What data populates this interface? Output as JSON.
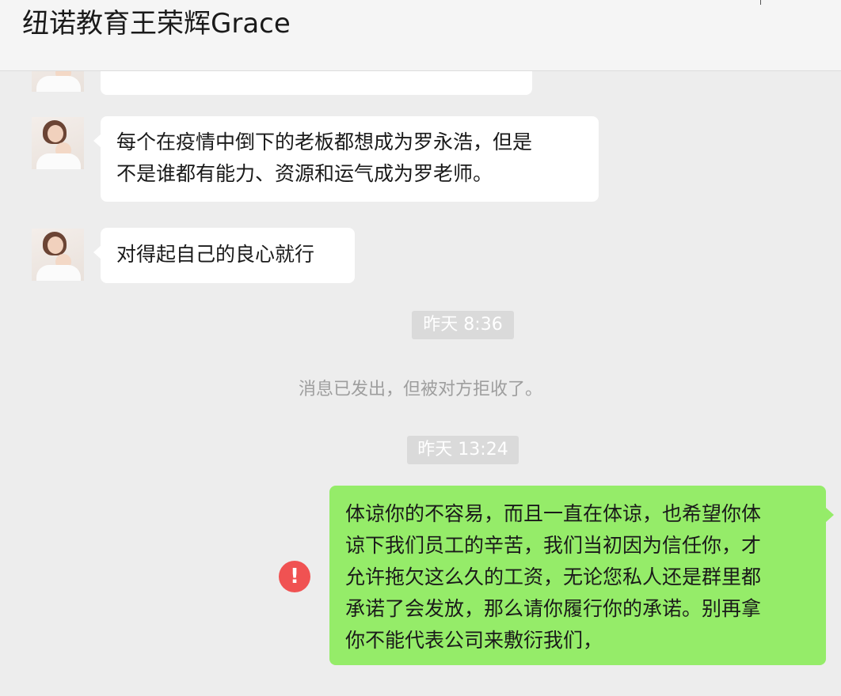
{
  "header": {
    "title": "纽诺教育王荣辉Grace"
  },
  "messages": {
    "partial": {
      "text": "…"
    },
    "m1": {
      "line1": "每个在疫情中倒下的老板都想成为罗永浩，但是",
      "line2": "不是谁都有能力、资源和运气成为罗老师。"
    },
    "m2": {
      "text": "对得起自己的良心就行"
    },
    "ts1": "昨天 8:36",
    "system": "消息已发出，但被对方拒收了。",
    "ts2": "昨天 13:24",
    "out": {
      "lines": [
        "体谅你的不容易，而且一直在体谅，也希望你体",
        "谅下我们员工的辛苦，我们当初因为信任你，才",
        "允许拖欠这么久的工资，无论您私人还是群里都",
        "承诺了会发放，那么请你履行你的承诺。别再拿",
        "你不能代表公司来敷衍我们，"
      ],
      "error_icon_glyph": "!"
    }
  },
  "colors": {
    "accent_green": "#95ec69",
    "error_red": "#f05252",
    "background": "#ededed"
  }
}
